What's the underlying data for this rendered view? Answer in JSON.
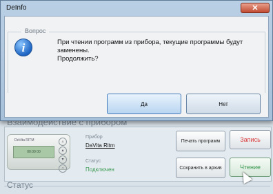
{
  "background_window": {
    "group_title": "Взаимодействие с прибором",
    "device_label": "Прибор",
    "device_name": "DaVita Ritm",
    "status_label": "Статус",
    "status_value": "Подключен",
    "buttons": {
      "print_programs": "Печать программ",
      "save_to_archive": "Сохранить в архив",
      "write": "Запись",
      "read": "Чтение"
    },
    "status_section_title": "Статус"
  },
  "dialog": {
    "title": "DeInfo",
    "close_glyph": "✕",
    "group_legend": "Вопрос",
    "message_line1": "При чтении программ из прибора, текущие программы будут заменены.",
    "message_line2": "Продолжить?",
    "yes_label": "Да",
    "no_label": "Нет"
  },
  "colors": {
    "write_accent": "#d93b3b",
    "read_accent": "#3c9a52",
    "close_button": "#c24a32"
  },
  "icons": [
    "info-icon",
    "close-icon",
    "mouse-pointer-icon"
  ]
}
